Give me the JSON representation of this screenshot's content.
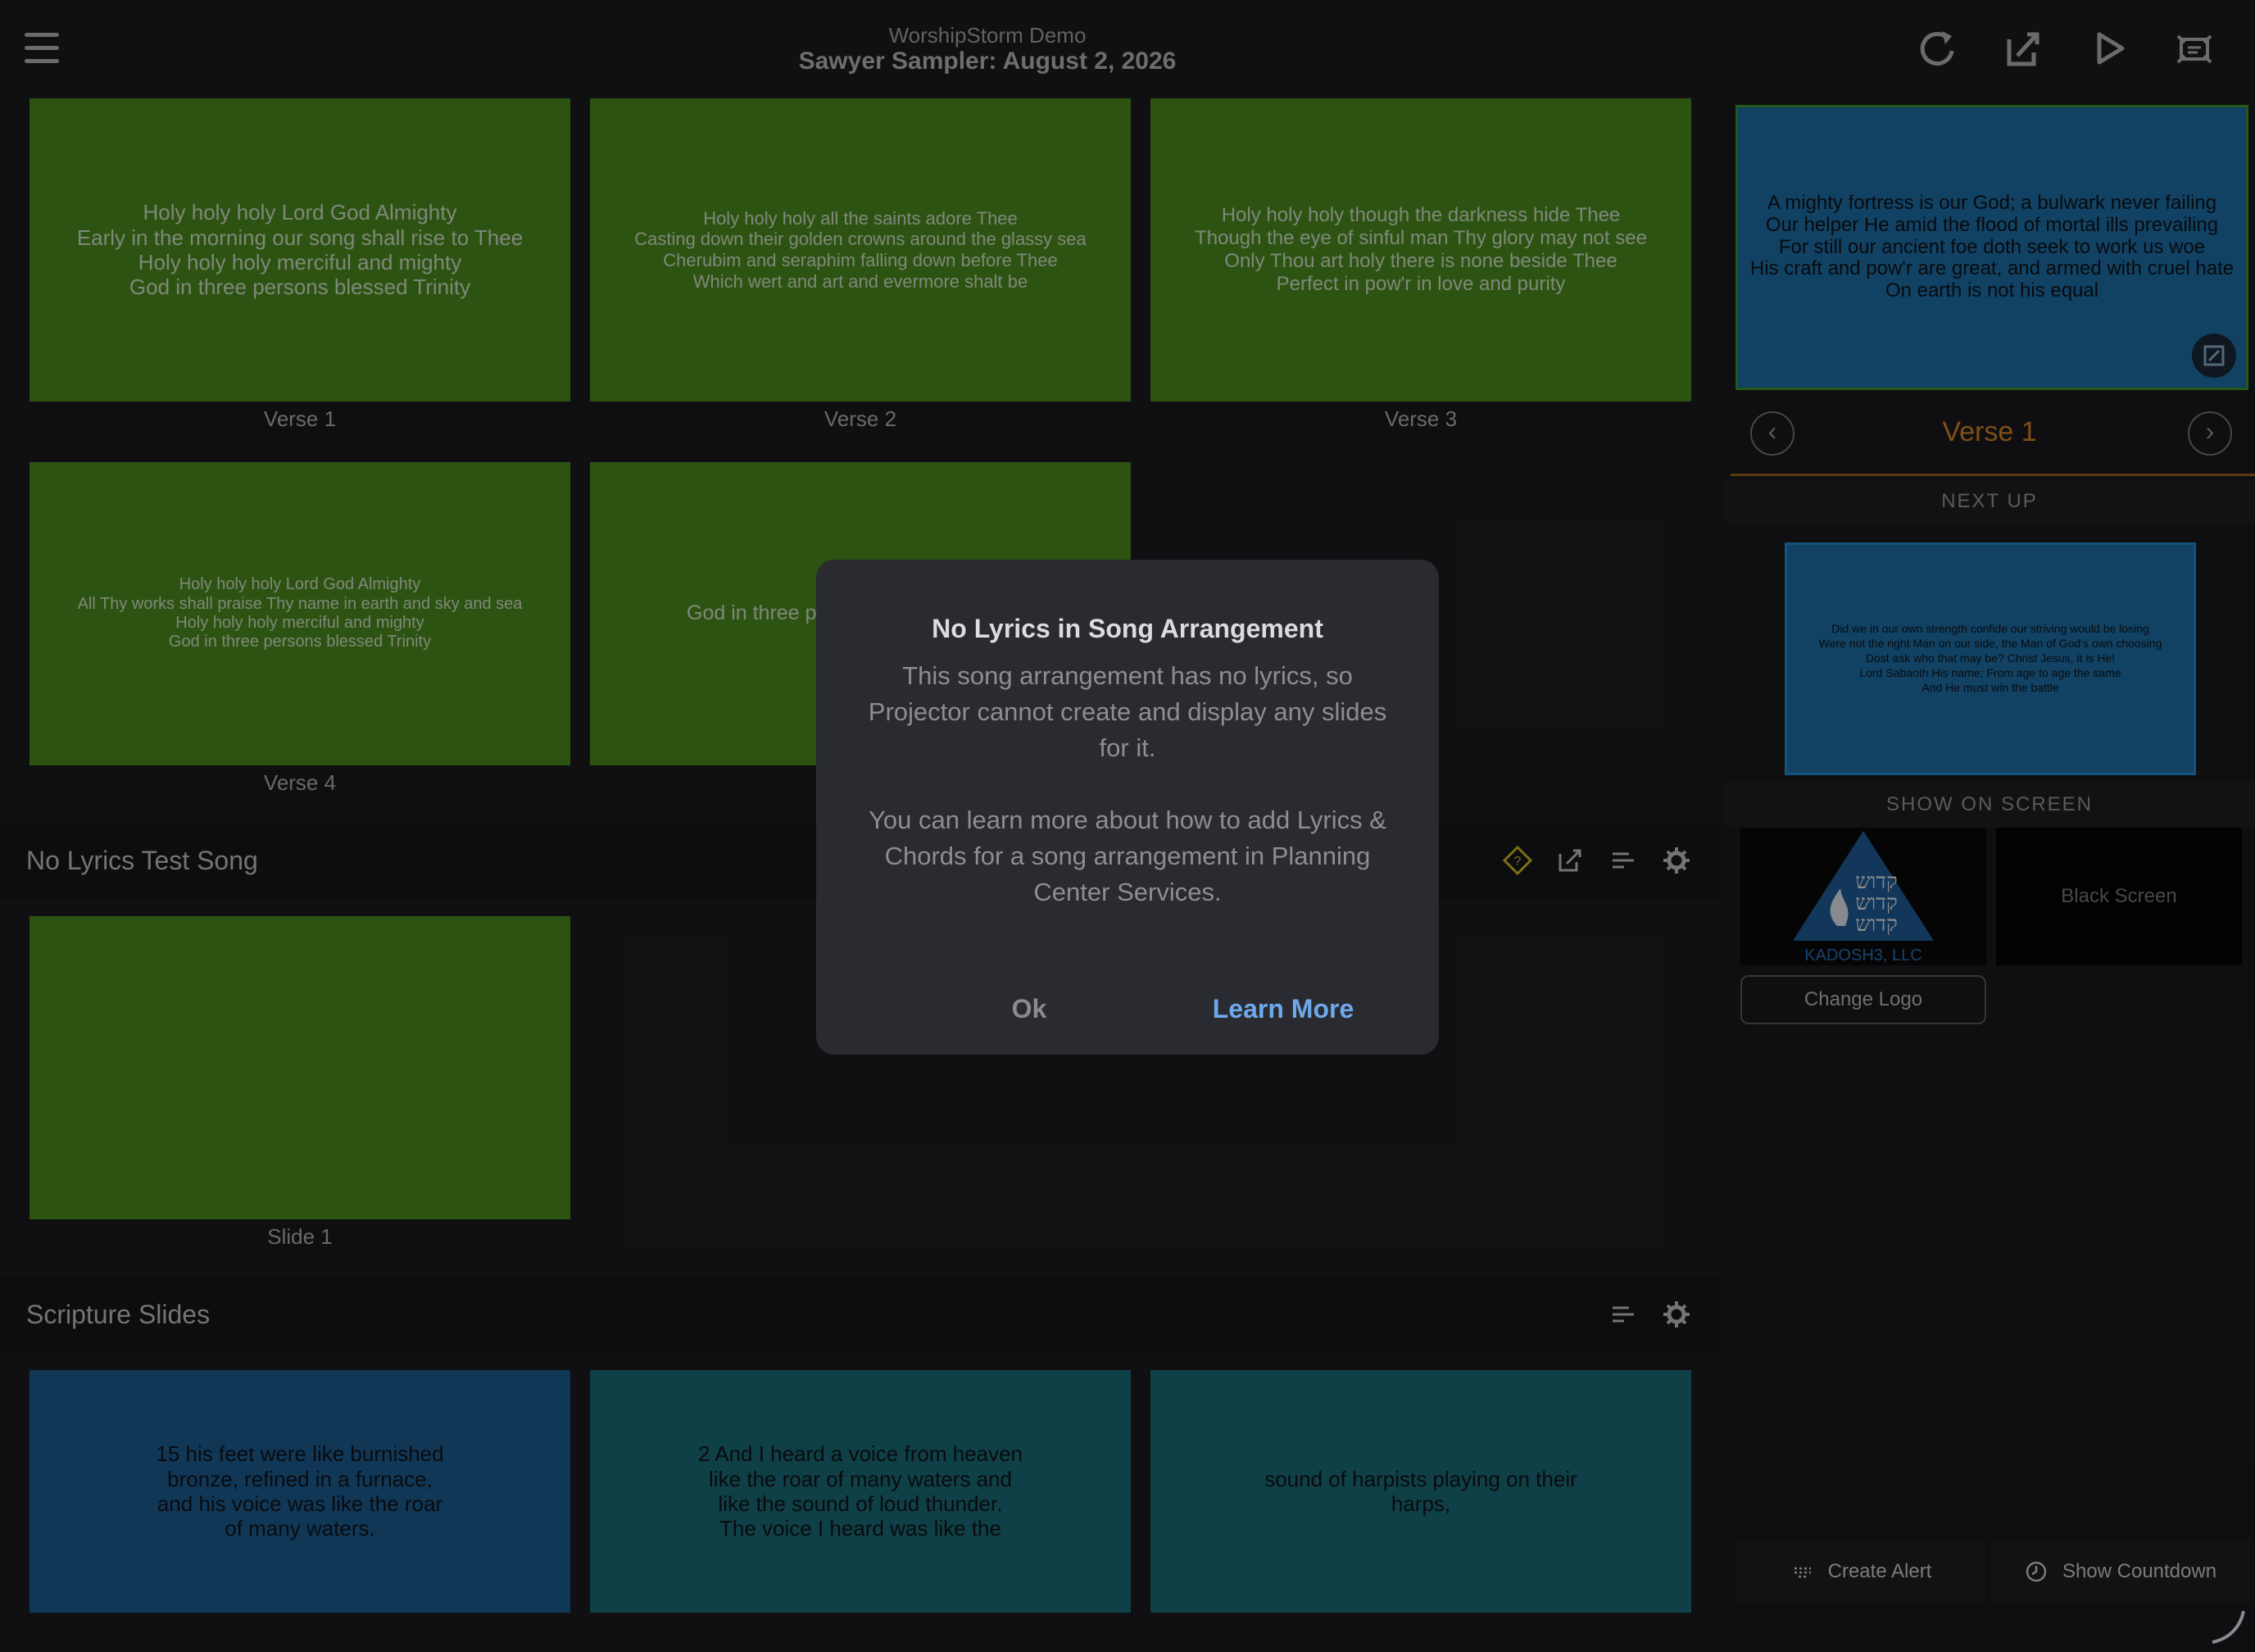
{
  "header": {
    "subtitle": "WorshipStorm Demo",
    "title": "Sawyer Sampler: August 2, 2026",
    "icons": [
      "refresh-icon",
      "edit-icon",
      "play-icon",
      "projector-icon"
    ]
  },
  "song1": {
    "slides": [
      {
        "text": "Holy holy holy Lord God Almighty\nEarly in the morning our song shall rise to Thee\nHoly holy holy merciful and mighty\nGod in three persons blessed Trinity",
        "caption": "Verse 1"
      },
      {
        "text": "Holy holy holy all the saints adore Thee\nCasting down their golden crowns around the glassy sea\nCherubim and seraphim falling down before Thee\nWhich wert and art and evermore shalt be",
        "caption": "Verse 2"
      },
      {
        "text": "Holy holy holy though the darkness hide Thee\nThough the eye of sinful man Thy glory may not see\nOnly Thou art holy there is none beside Thee\nPerfect in pow'r in love and purity",
        "caption": "Verse 3"
      },
      {
        "text": "Holy holy holy Lord God Almighty\nAll Thy works shall praise Thy name in earth and sky and sea\nHoly holy holy merciful and mighty\nGod in three persons blessed Trinity",
        "caption": "Verse 4"
      },
      {
        "text": "God in three p",
        "caption": ""
      }
    ]
  },
  "song2": {
    "title": "No Lyrics Test Song",
    "slides": [
      {
        "text": "",
        "caption": "Slide 1"
      }
    ]
  },
  "scripture": {
    "title": "Scripture Slides",
    "slides": [
      {
        "text": "15 his feet were like burnished\nbronze, refined in a furnace,\nand his voice was like the roar\nof many waters."
      },
      {
        "text": "2 And I heard a voice from heaven\nlike the roar of many waters and\nlike the sound of loud thunder.\nThe voice I heard was like the"
      },
      {
        "text": "sound of harpists playing on their\nharps,"
      }
    ]
  },
  "right": {
    "live_text": "A mighty fortress is our God; a bulwark never failing\nOur helper He amid the flood of mortal ills prevailing\nFor still our ancient foe doth seek to work us woe\nHis craft and pow'r are great, and armed with cruel hate\nOn earth is not his equal",
    "current_label": "Verse 1",
    "next_up_label": "NEXT UP",
    "next_text": "Did we in our own strength confide our striving would be losing\nWere not the right Man on our side, the Man of God's own choosing\nDost ask who that may be? Christ Jesus, it is He!\nLord Sabaoth His name; From age to age the same\nAnd He must win the battle",
    "show_on_screen_label": "SHOW ON SCREEN",
    "logo_text": "KADOSH3, LLC",
    "black_screen": "Black Screen",
    "change_logo": "Change Logo",
    "create_alert": "Create Alert",
    "show_countdown": "Show Countdown"
  },
  "modal": {
    "title": "No Lyrics in Song Arrangement",
    "body": "This song arrangement has no lyrics, so Projector cannot create and display any slides for it.\n\nYou can learn more about how to add Lyrics & Chords for a song arrangement in Planning Center Services.",
    "ok": "Ok",
    "learn_more": "Learn More"
  },
  "colors": {
    "song_slide_bg": "#4f8f20",
    "scripture_bg": "#1e5f96",
    "accent_orange": "#d98826",
    "link_blue": "#6fa8ea"
  }
}
